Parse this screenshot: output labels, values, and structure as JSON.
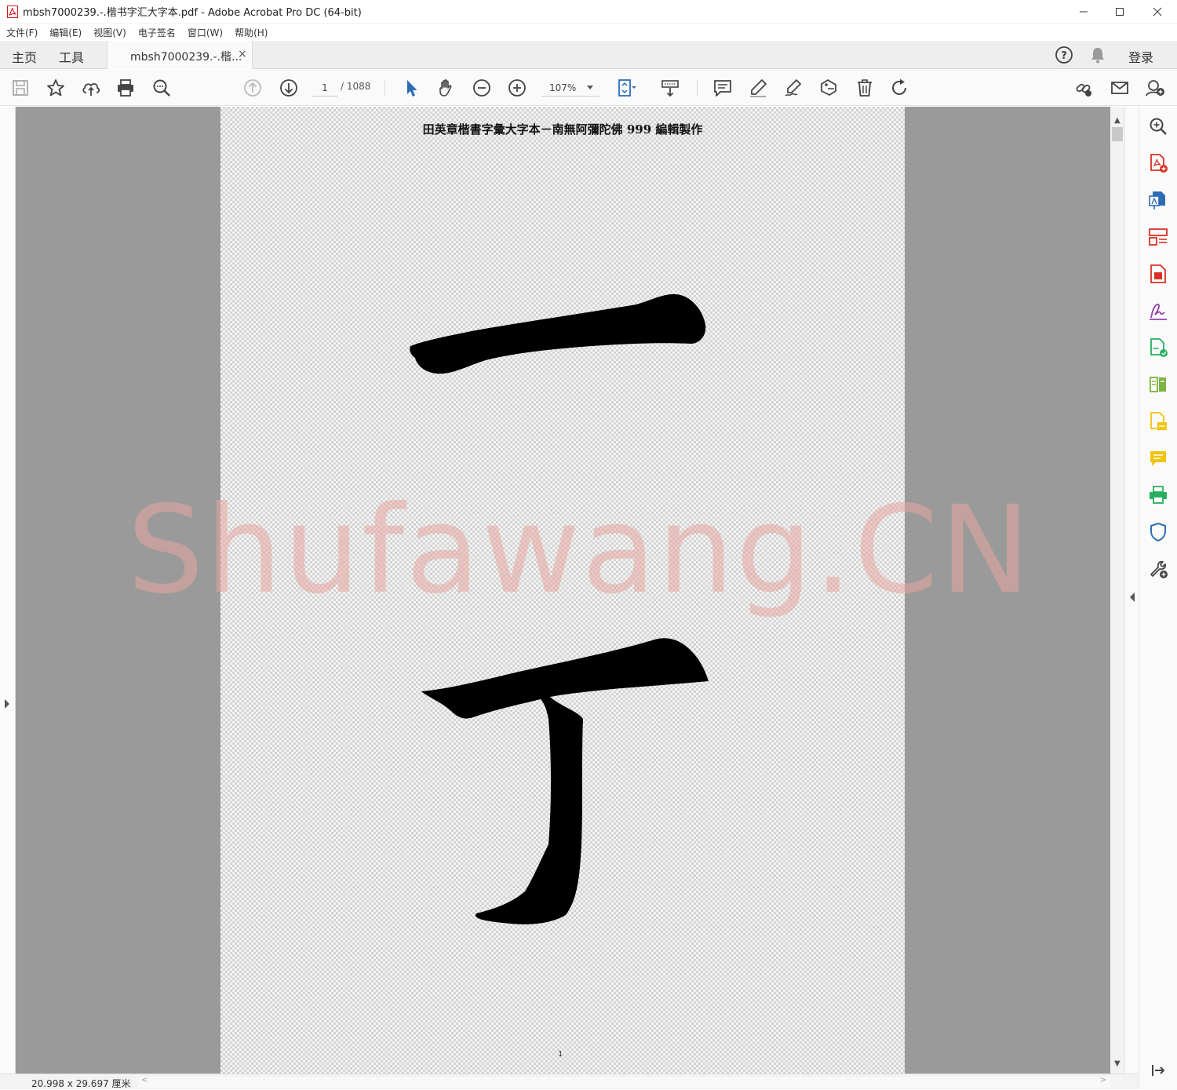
{
  "window": {
    "title": "mbsh7000239.-.楷书字汇大字本.pdf - Adobe Acrobat Pro DC (64-bit)"
  },
  "menu": [
    "文件(F)",
    "编辑(E)",
    "视图(V)",
    "电子签名",
    "窗口(W)",
    "帮助(H)"
  ],
  "tabs": {
    "home": "主页",
    "tools": "工具",
    "document": "mbsh7000239.-.楷...",
    "close": "×",
    "signin": "登录"
  },
  "toolbar": {
    "page_current": "1",
    "page_total": "/ 1088",
    "zoom": "107%"
  },
  "document": {
    "header": "田英章楷書字彙大字本－南無阿彌陀佛 999 編輯製作",
    "page_number": "1",
    "watermark": "Shufawang.CN"
  },
  "status": {
    "dimensions": "20.998 x 29.697 厘米"
  },
  "scroll": {
    "up": "▲",
    "down": "▼",
    "left": "<",
    "right": ">"
  },
  "colors": {
    "accent_blue": "#2d6db5",
    "acrobat_red": "#d71920",
    "watermark": "#e8a7a0"
  },
  "right_pane_tools": [
    {
      "icon": "zoom-search-icon",
      "color": "#444444"
    },
    {
      "icon": "create-pdf-icon",
      "color": "#d93025"
    },
    {
      "icon": "export-pdf-icon",
      "color": "#2d6db5"
    },
    {
      "icon": "organize-pages-icon",
      "color": "#d93025"
    },
    {
      "icon": "edit-pdf-icon",
      "color": "#d93025"
    },
    {
      "icon": "fill-sign-icon",
      "color": "#8e44ad"
    },
    {
      "icon": "send-for-signature-icon",
      "color": "#27ae60"
    },
    {
      "icon": "compare-files-icon",
      "color": "#7cb342"
    },
    {
      "icon": "scan-icon",
      "color": "#f1c40f"
    },
    {
      "icon": "comment-icon",
      "color": "#f1c40f"
    },
    {
      "icon": "print-production-icon",
      "color": "#27ae60"
    },
    {
      "icon": "protect-icon",
      "color": "#2d6db5"
    },
    {
      "icon": "more-tools-icon",
      "color": "#444444"
    }
  ]
}
